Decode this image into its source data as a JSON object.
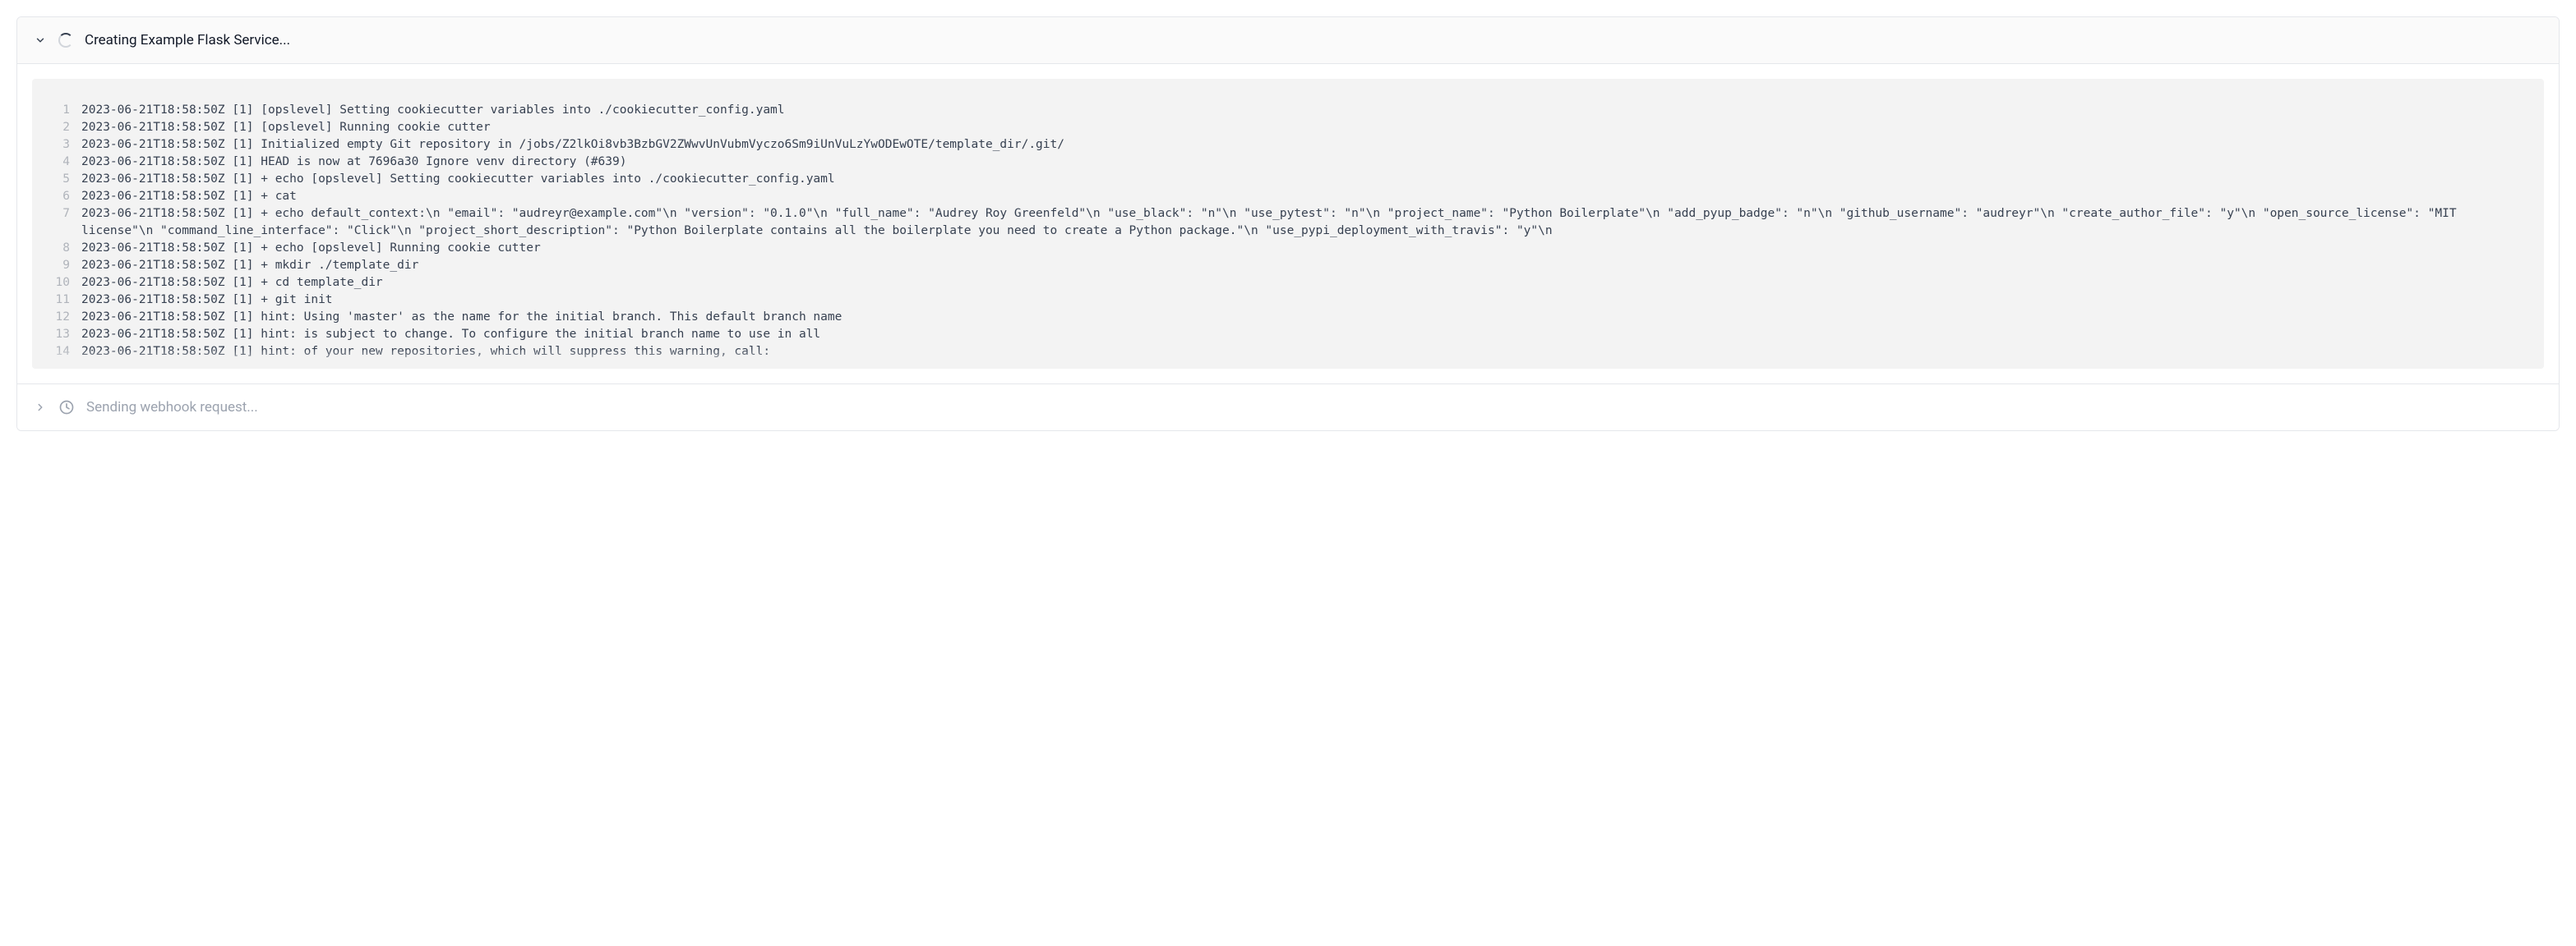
{
  "header": {
    "title": "Creating Example Flask Service..."
  },
  "logs": [
    {
      "n": 1,
      "text": "2023-06-21T18:58:50Z [1] [opslevel] Setting cookiecutter variables into ./cookiecutter_config.yaml"
    },
    {
      "n": 2,
      "text": "2023-06-21T18:58:50Z [1] [opslevel] Running cookie cutter"
    },
    {
      "n": 3,
      "text": "2023-06-21T18:58:50Z [1] Initialized empty Git repository in /jobs/Z2lkOi8vb3BzbGV2ZWwvUnVubmVyczo6Sm9iUnVuLzYwODEwOTE/template_dir/.git/"
    },
    {
      "n": 4,
      "text": "2023-06-21T18:58:50Z [1] HEAD is now at 7696a30 Ignore venv directory (#639)"
    },
    {
      "n": 5,
      "text": "2023-06-21T18:58:50Z [1] + echo [opslevel] Setting cookiecutter variables into ./cookiecutter_config.yaml"
    },
    {
      "n": 6,
      "text": "2023-06-21T18:58:50Z [1] + cat"
    },
    {
      "n": 7,
      "text": "2023-06-21T18:58:50Z [1] + echo default_context:\\n \"email\": \"audreyr@example.com\"\\n \"version\": \"0.1.0\"\\n \"full_name\": \"Audrey Roy Greenfeld\"\\n \"use_black\": \"n\"\\n \"use_pytest\": \"n\"\\n \"project_name\": \"Python Boilerplate\"\\n \"add_pyup_badge\": \"n\"\\n \"github_username\": \"audreyr\"\\n \"create_author_file\": \"y\"\\n \"open_source_license\": \"MIT license\"\\n \"command_line_interface\": \"Click\"\\n \"project_short_description\": \"Python Boilerplate contains all the boilerplate you need to create a Python package.\"\\n \"use_pypi_deployment_with_travis\": \"y\"\\n"
    },
    {
      "n": 8,
      "text": "2023-06-21T18:58:50Z [1] + echo [opslevel] Running cookie cutter"
    },
    {
      "n": 9,
      "text": "2023-06-21T18:58:50Z [1] + mkdir ./template_dir"
    },
    {
      "n": 10,
      "text": "2023-06-21T18:58:50Z [1] + cd template_dir"
    },
    {
      "n": 11,
      "text": "2023-06-21T18:58:50Z [1] + git init"
    },
    {
      "n": 12,
      "text": "2023-06-21T18:58:50Z [1] hint: Using 'master' as the name for the initial branch. This default branch name"
    },
    {
      "n": 13,
      "text": "2023-06-21T18:58:50Z [1] hint: is subject to change. To configure the initial branch name to use in all"
    },
    {
      "n": 14,
      "text": "2023-06-21T18:58:50Z [1] hint: of your new repositories, which will suppress this warning, call:"
    }
  ],
  "footer": {
    "title": "Sending webhook request..."
  }
}
